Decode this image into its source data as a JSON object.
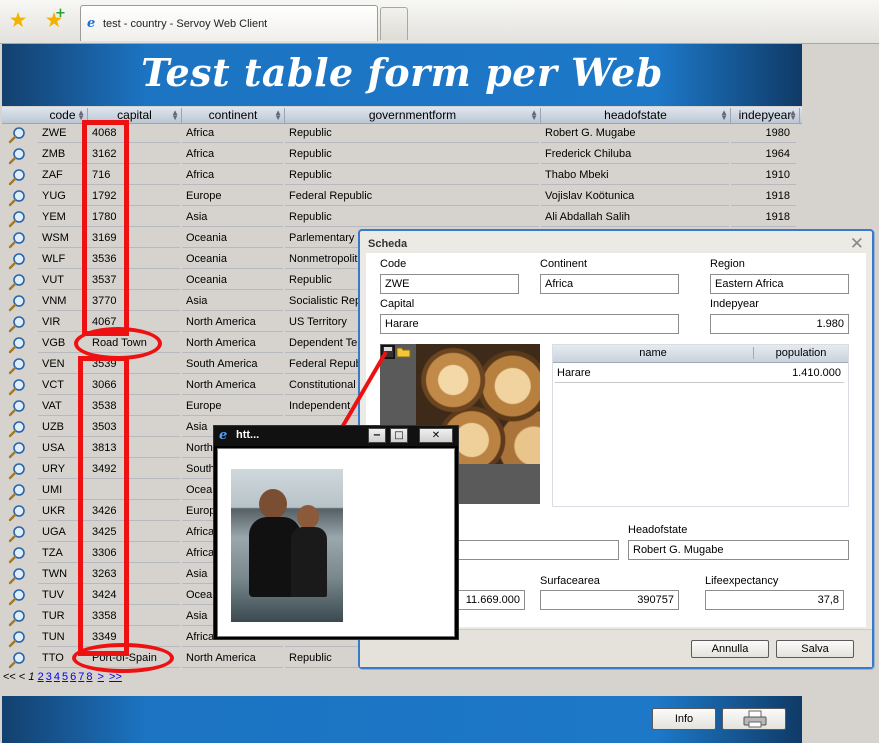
{
  "browser": {
    "tab_title": "test - country - Servoy Web Client"
  },
  "header": {
    "title": "Test table form per Web"
  },
  "table": {
    "columns": [
      "code",
      "capital",
      "continent",
      "governmentform",
      "headofstate",
      "indepyear"
    ],
    "rows": [
      {
        "code": "ZWE",
        "capital": "4068",
        "continent": "Africa",
        "governmentform": "Republic",
        "headofstate": "Robert G. Mugabe",
        "indepyear": "1980"
      },
      {
        "code": "ZMB",
        "capital": "3162",
        "continent": "Africa",
        "governmentform": "Republic",
        "headofstate": "Frederick Chiluba",
        "indepyear": "1964"
      },
      {
        "code": "ZAF",
        "capital": "716",
        "continent": "Africa",
        "governmentform": "Republic",
        "headofstate": "Thabo Mbeki",
        "indepyear": "1910"
      },
      {
        "code": "YUG",
        "capital": "1792",
        "continent": "Europe",
        "governmentform": "Federal Republic",
        "headofstate": "Vojislav Koötunica",
        "indepyear": "1918"
      },
      {
        "code": "YEM",
        "capital": "1780",
        "continent": "Asia",
        "governmentform": "Republic",
        "headofstate": "Ali Abdallah Salih",
        "indepyear": "1918"
      },
      {
        "code": "WSM",
        "capital": "3169",
        "continent": "Oceania",
        "governmentform": "Parlementary M",
        "headofstate": "",
        "indepyear": ""
      },
      {
        "code": "WLF",
        "capital": "3536",
        "continent": "Oceania",
        "governmentform": "Nonmetropolita",
        "headofstate": "",
        "indepyear": ""
      },
      {
        "code": "VUT",
        "capital": "3537",
        "continent": "Oceania",
        "governmentform": "Republic",
        "headofstate": "",
        "indepyear": ""
      },
      {
        "code": "VNM",
        "capital": "3770",
        "continent": "Asia",
        "governmentform": "Socialistic Repu",
        "headofstate": "",
        "indepyear": ""
      },
      {
        "code": "VIR",
        "capital": "4067",
        "continent": "North America",
        "governmentform": "US Territory",
        "headofstate": "",
        "indepyear": ""
      },
      {
        "code": "VGB",
        "capital": "Road Town",
        "continent": "North America",
        "governmentform": "Dependent Ter",
        "headofstate": "",
        "indepyear": ""
      },
      {
        "code": "VEN",
        "capital": "3539",
        "continent": "South America",
        "governmentform": "Federal Repub",
        "headofstate": "",
        "indepyear": ""
      },
      {
        "code": "VCT",
        "capital": "3066",
        "continent": "North America",
        "governmentform": "Constitutional",
        "headofstate": "",
        "indepyear": ""
      },
      {
        "code": "VAT",
        "capital": "3538",
        "continent": "Europe",
        "governmentform": "Independent",
        "headofstate": "",
        "indepyear": ""
      },
      {
        "code": "UZB",
        "capital": "3503",
        "continent": "Asia",
        "governmentform": "",
        "headofstate": "",
        "indepyear": ""
      },
      {
        "code": "USA",
        "capital": "3813",
        "continent": "North",
        "governmentform": "",
        "headofstate": "",
        "indepyear": ""
      },
      {
        "code": "URY",
        "capital": "3492",
        "continent": "South",
        "governmentform": "",
        "headofstate": "",
        "indepyear": ""
      },
      {
        "code": "UMI",
        "capital": "",
        "continent": "Ocean",
        "governmentform": "",
        "headofstate": "",
        "indepyear": ""
      },
      {
        "code": "UKR",
        "capital": "3426",
        "continent": "Europ",
        "governmentform": "",
        "headofstate": "",
        "indepyear": ""
      },
      {
        "code": "UGA",
        "capital": "3425",
        "continent": "Africa",
        "governmentform": "",
        "headofstate": "",
        "indepyear": ""
      },
      {
        "code": "TZA",
        "capital": "3306",
        "continent": "Africa",
        "governmentform": "",
        "headofstate": "",
        "indepyear": ""
      },
      {
        "code": "TWN",
        "capital": "3263",
        "continent": "Asia",
        "governmentform": "",
        "headofstate": "",
        "indepyear": ""
      },
      {
        "code": "TUV",
        "capital": "3424",
        "continent": "Ocean",
        "governmentform": "",
        "headofstate": "",
        "indepyear": ""
      },
      {
        "code": "TUR",
        "capital": "3358",
        "continent": "Asia",
        "governmentform": "",
        "headofstate": "",
        "indepyear": ""
      },
      {
        "code": "TUN",
        "capital": "3349",
        "continent": "Africa",
        "governmentform": "",
        "headofstate": "",
        "indepyear": ""
      },
      {
        "code": "TTO",
        "capital": "Port-of-Spain",
        "continent": "North America",
        "governmentform": "Republic",
        "headofstate": "",
        "indepyear": ""
      }
    ]
  },
  "pager": {
    "first": "<<",
    "prev": "<",
    "current": "1",
    "pages": [
      "2",
      "3",
      "4",
      "5",
      "6",
      "7",
      "8"
    ],
    "next": ">",
    "last": ">>"
  },
  "footer": {
    "info_label": "Info",
    "print_icon": "printer-icon"
  },
  "dialog": {
    "title": "Scheda",
    "labels": {
      "code": "Code",
      "continent": "Continent",
      "region": "Region",
      "capital": "Capital",
      "indepyear": "Indepyear",
      "headofstate": "Headofstate",
      "surfacearea": "Surfacearea",
      "lifeexpectancy": "Lifeexpectancy"
    },
    "values": {
      "code": "ZWE",
      "continent": "Africa",
      "region": "Eastern Africa",
      "capital": "Harare",
      "indepyear": "1.980",
      "headofstate": "Robert G. Mugabe",
      "population": "11.669.000",
      "surfacearea": "390757",
      "lifeexpectancy": "37,8"
    },
    "cities_table": {
      "columns": [
        "name",
        "population"
      ],
      "rows": [
        {
          "name": "Harare",
          "population": "1.410.000"
        }
      ]
    },
    "buttons": {
      "cancel": "Annulla",
      "save": "Salva"
    }
  },
  "popup": {
    "title": "htt..."
  },
  "colors": {
    "banner": "#1d78c8",
    "annotation": "#ee1111",
    "dialog_border": "#3a78c8"
  }
}
